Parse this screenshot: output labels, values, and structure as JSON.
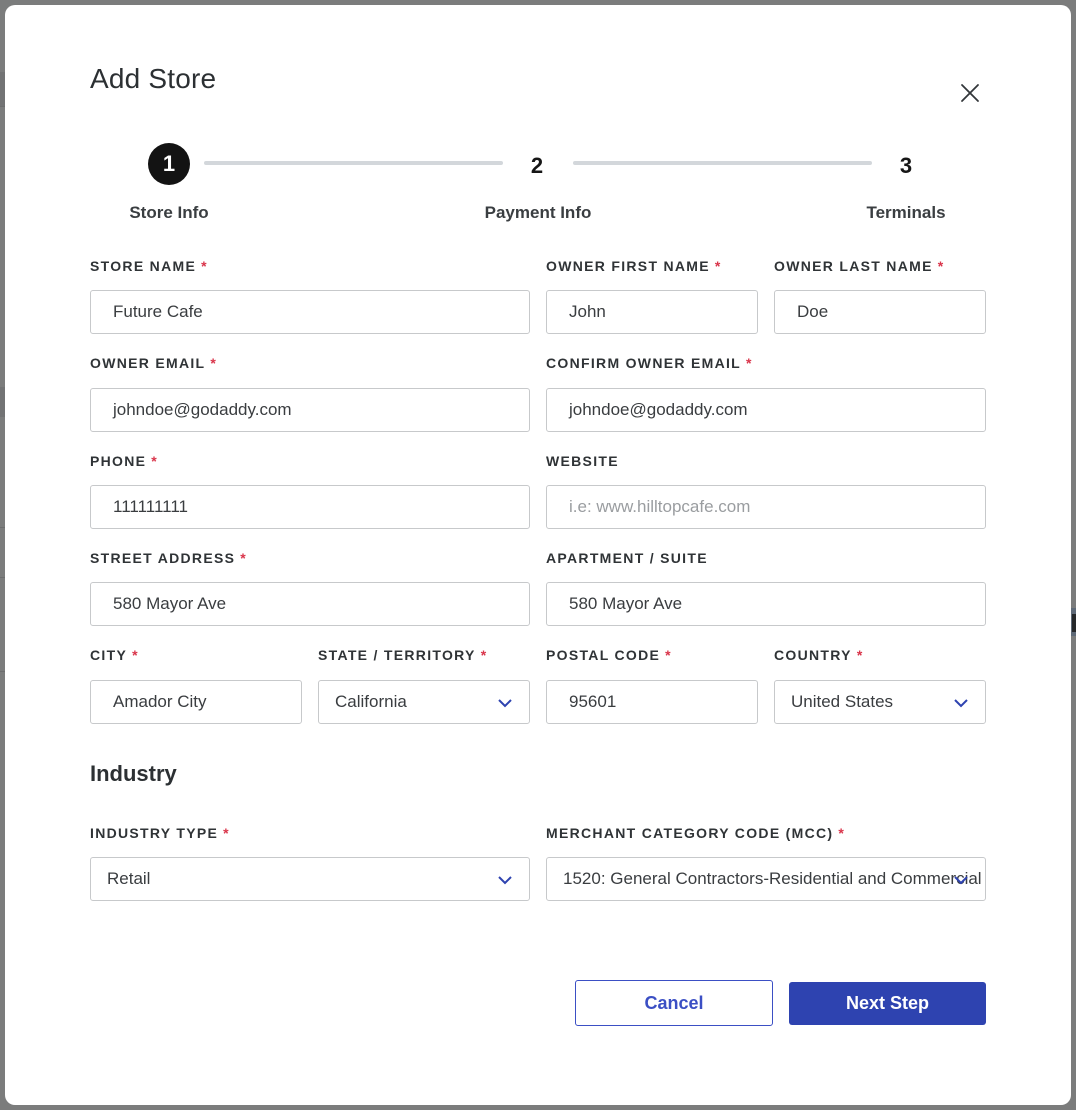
{
  "modal": {
    "title": "Add Store",
    "close_icon": "close-icon"
  },
  "stepper": {
    "current_step": 1,
    "steps": [
      {
        "number": "1",
        "label": "Store Info"
      },
      {
        "number": "2",
        "label": "Payment Info"
      },
      {
        "number": "3",
        "label": "Terminals"
      }
    ]
  },
  "form": {
    "required_marker": "*",
    "store_name": {
      "label": "Store Name",
      "value": "Future Cafe",
      "required": true
    },
    "owner_first_name": {
      "label": "Owner First Name",
      "value": "John",
      "required": true
    },
    "owner_last_name": {
      "label": "Owner Last Name",
      "value": "Doe",
      "required": true
    },
    "owner_email": {
      "label": "Owner Email",
      "value": "johndoe@godaddy.com",
      "required": true
    },
    "confirm_owner_email": {
      "label": "Confirm Owner Email",
      "value": "johndoe@godaddy.com",
      "required": true
    },
    "phone": {
      "label": "Phone",
      "value": "111111111",
      "required": true
    },
    "website": {
      "label": "Website",
      "value": "",
      "placeholder": "i.e: www.hilltopcafe.com",
      "required": false
    },
    "street_address": {
      "label": "Street Address",
      "value": "580 Mayor Ave",
      "required": true
    },
    "apartment_suite": {
      "label": "Apartment / Suite",
      "value": "580 Mayor Ave",
      "required": false
    },
    "city": {
      "label": "City",
      "value": "Amador City",
      "required": true
    },
    "state": {
      "label": "State / Territory",
      "value": "California",
      "required": true
    },
    "postal_code": {
      "label": "Postal Code",
      "value": "95601",
      "required": true
    },
    "country": {
      "label": "Country",
      "value": "United States",
      "required": true
    }
  },
  "industry": {
    "section_title": "Industry",
    "industry_type": {
      "label": "Industry Type",
      "value": "Retail",
      "required": true
    },
    "mcc": {
      "label": "Merchant Category Code (MCC)",
      "value": "1520: General Contractors-Residential and Commercial",
      "required": true
    }
  },
  "actions": {
    "cancel_label": "Cancel",
    "next_label": "Next Step"
  },
  "colors": {
    "accent": "#2e43b0",
    "required": "#d9344a",
    "step_active": "#131313",
    "step_track": "#d3d7db",
    "overlay": "#7b7c7c"
  }
}
